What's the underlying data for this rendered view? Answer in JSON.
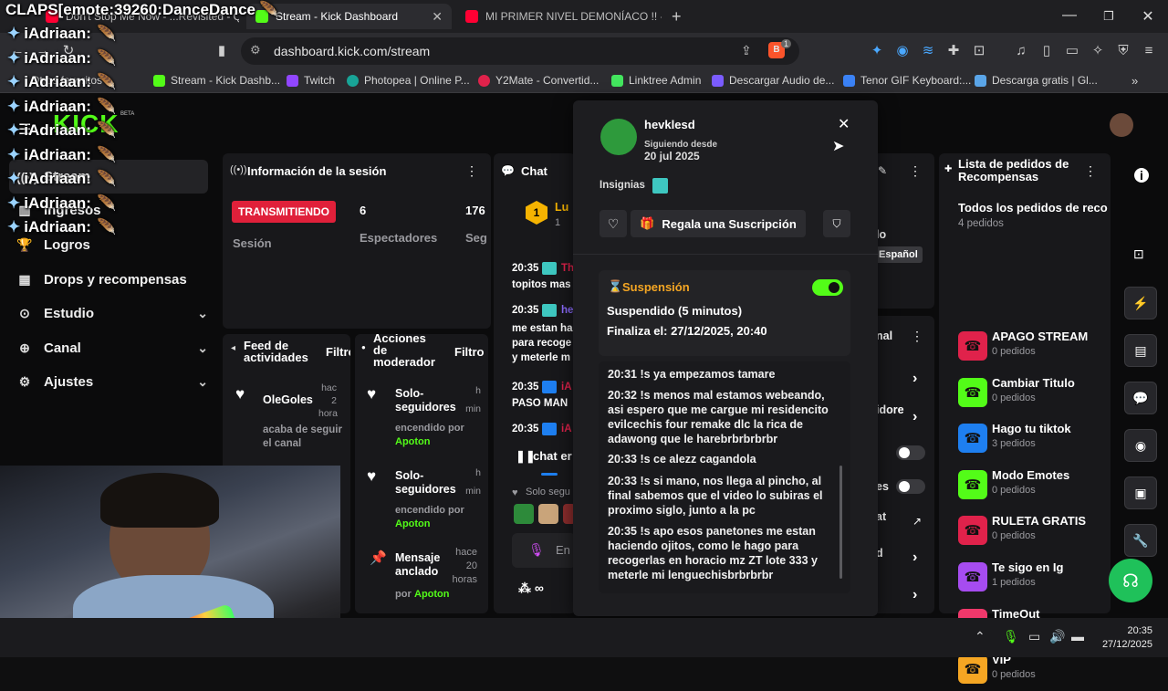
{
  "overlay": {
    "top_line": "CLAPS[emote:39260:DanceDance",
    "repeated_name": "iAdriaan:",
    "repeat_count": 9
  },
  "browser": {
    "tabs": [
      {
        "label": "Don't Stop Me Now - ...Revisited - Q",
        "active": false
      },
      {
        "label": "Stream - Kick Dashboard",
        "active": true
      },
      {
        "label": "MI PRIMER NIVEL DEMONÍACO !! - D",
        "active": false
      }
    ],
    "url": "dashboard.kick.com/stream",
    "bookmarks": [
      "Otros favoritos",
      "Stream - Kick Dashb...",
      "Twitch",
      "Photopea | Online P...",
      "Y2Mate - Convertid...",
      "Linktree Admin",
      "Descargar Audio de...",
      "Tenor GIF Keyboard:...",
      "Descarga gratis | Gl..."
    ],
    "brave_badge": "1"
  },
  "sidebar": {
    "logo": "KICK",
    "logo_badge": "BETA",
    "items": [
      {
        "label": "Stream",
        "icon": "broadcast-icon"
      },
      {
        "label": "Ingresos",
        "icon": "chart-icon"
      },
      {
        "label": "Logros",
        "icon": "trophy-icon"
      },
      {
        "label": "Drops y recompensas",
        "icon": "gift-icon"
      },
      {
        "label": "Estudio",
        "icon": "studio-icon"
      },
      {
        "label": "Canal",
        "icon": "globe-icon"
      },
      {
        "label": "Ajustes",
        "icon": "gear-icon"
      }
    ]
  },
  "session": {
    "title": "Información de la sesión",
    "live_badge": "TRANSMITIENDO",
    "session_label": "Sesión",
    "viewers_value": "6",
    "viewers_label": "Espectadores",
    "followers_value": "176",
    "followers_label": "Seg"
  },
  "activity_feed": {
    "title_line1": "Feed de",
    "title_line2": "actividades",
    "filter": "Filtro",
    "item": {
      "name": "OleGoles",
      "time": "hac\n2\nhora",
      "text": "acaba de seguir el canal"
    }
  },
  "mod_actions": {
    "title_line1": "Acciones",
    "title_line2": "de",
    "title_line3": "moderador",
    "filter": "Filtro",
    "items": [
      {
        "title": "Solo-seguidores",
        "sub": "encendido por",
        "by": "Apoton",
        "time": "h\nmin"
      },
      {
        "title": "Solo-seguidores",
        "sub": "encendido por",
        "by": "Apoton",
        "time": "h\nmin"
      },
      {
        "title": "Mensaje anclado",
        "sub": "por",
        "by": "Apoton",
        "time": "hace\n20\nhoras"
      }
    ]
  },
  "chat": {
    "title": "Chat",
    "pinned_name": "Lu",
    "pinned_sub": "1",
    "messages": [
      {
        "time": "20:35",
        "user": "Th",
        "text": "topitos mas"
      },
      {
        "time": "20:35",
        "user": "he",
        "text": "me estan ha para recoge y meterle m"
      },
      {
        "time": "20:35",
        "user": "iA",
        "text": "PASO MAN"
      },
      {
        "time": "20:35",
        "user": "iA",
        "text": ""
      }
    ],
    "paused": "chat er",
    "mode": "Solo segu",
    "input_placeholder": "En"
  },
  "popover": {
    "username": "hevklesd",
    "following_label": "Siguiendo desde",
    "following_date": "20 jul 2025",
    "badges_label": "Insignias",
    "gift_button": "Regala una Suscripción",
    "suspension_title": "Suspensión",
    "suspension_status": "Suspendido (5 minutos)",
    "suspension_end": "Finaliza el: 27/12/2025, 20:40",
    "toggle_on": true,
    "log": [
      "20:31 !s ya empezamos tamare",
      "20:32 !s menos mal estamos webeando, asi espero que me cargue mi residencito evilcechis four remake dlc la rica de adawong que le harebrbrbrbrbr",
      "20:33 !s ce alezz cagandola",
      "20:33 !s si mano, nos llega al pincho, al final sabemos que el video lo subiras el proximo siglo, junto a la pc",
      "20:35 !s apo esos panetones me estan haciendo ojitos, como le hago para recogerlas en horacio mz ZT lote 333 y meterle mi lenguechisbrbrbrbr"
    ]
  },
  "stream_info": {
    "lang_label": "lo",
    "lang_value": "Español",
    "channel_label": "nal",
    "rows": [
      "idore",
      "es",
      "at",
      "d",
      ""
    ]
  },
  "rewards": {
    "title_line1": "Lista de pedidos de",
    "title_line2": "Recompensas",
    "all_label": "Todos los pedidos de reco",
    "all_count": "4 pedidos",
    "items": [
      {
        "name": "APAGO STREAM",
        "count": "0 pedidos",
        "color": "#e0224b"
      },
      {
        "name": "Cambiar Titulo",
        "count": "0 pedidos",
        "color": "#53fc18"
      },
      {
        "name": "Hago tu tiktok",
        "count": "3 pedidos",
        "color": "#1e7ff0"
      },
      {
        "name": "Modo Emotes",
        "count": "0 pedidos",
        "color": "#53fc18"
      },
      {
        "name": "RULETA GRATIS",
        "count": "0 pedidos",
        "color": "#e0224b"
      },
      {
        "name": "Te sigo en Ig",
        "count": "1 pedidos",
        "color": "#a64cf0"
      },
      {
        "name": "TimeOut",
        "count": "0 pedidos",
        "color": "#f0386b"
      },
      {
        "name": "VIP",
        "count": "0 pedidos",
        "color": "#f5a623"
      }
    ]
  },
  "taskbar": {
    "time": "20:35",
    "date": "27/12/2025"
  }
}
